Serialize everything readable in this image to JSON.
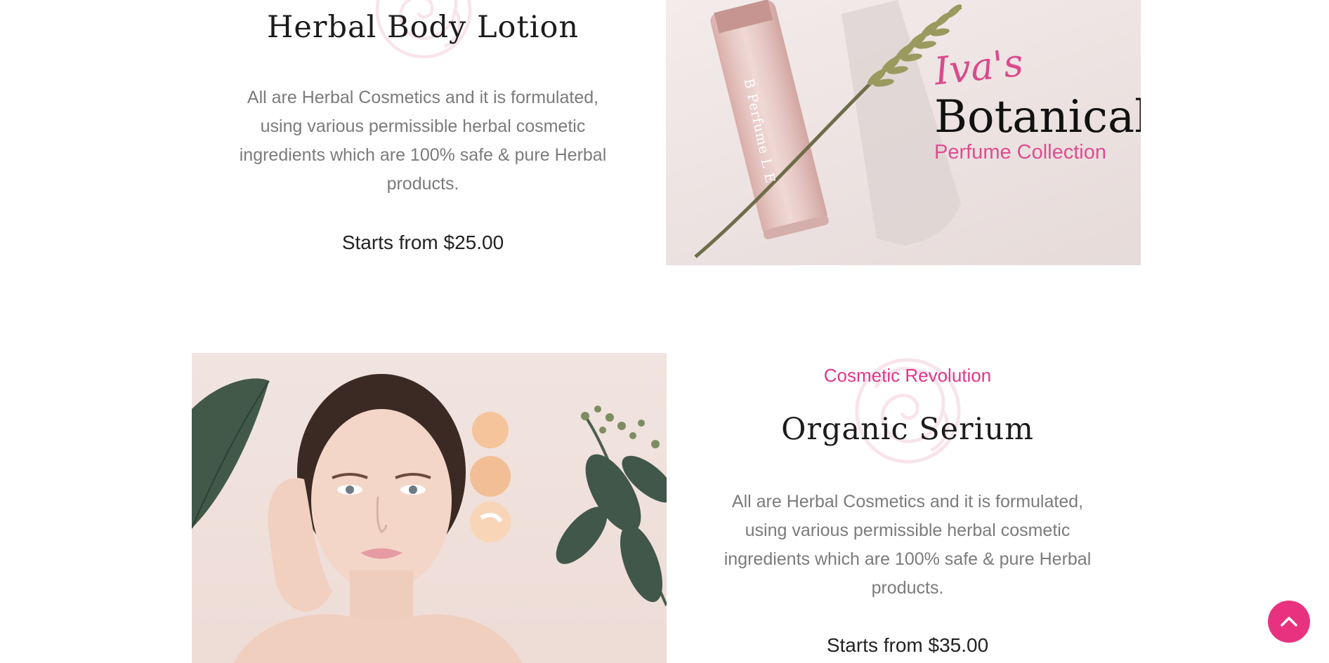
{
  "products": [
    {
      "title": "Herbal Body Lotion",
      "description": "All are Herbal Cosmetics and it is formulated, using various permissible herbal cosmetic ingredients which are 100% safe & pure Herbal products.",
      "price": "Starts from $25.00",
      "image": {
        "brand_script": "Iva's",
        "brand_main": "Botanical",
        "brand_sub": "Perfume Collection",
        "bottle_label": "B Perfume L E"
      }
    },
    {
      "kicker": "Cosmetic Revolution",
      "title": "Organic Serium",
      "description": "All are Herbal Cosmetics and it is formulated, using various permissible herbal cosmetic ingredients which are 100% safe & pure Herbal products.",
      "price": "Starts from $35.00"
    }
  ],
  "colors": {
    "accent": "#e8327f",
    "kicker": "#e0368a",
    "body_text": "#7b7b7b",
    "heading": "#1c1c1c"
  },
  "icons": {
    "rose": "rose-ornament-icon",
    "back_to_top": "chevron-up-icon"
  }
}
